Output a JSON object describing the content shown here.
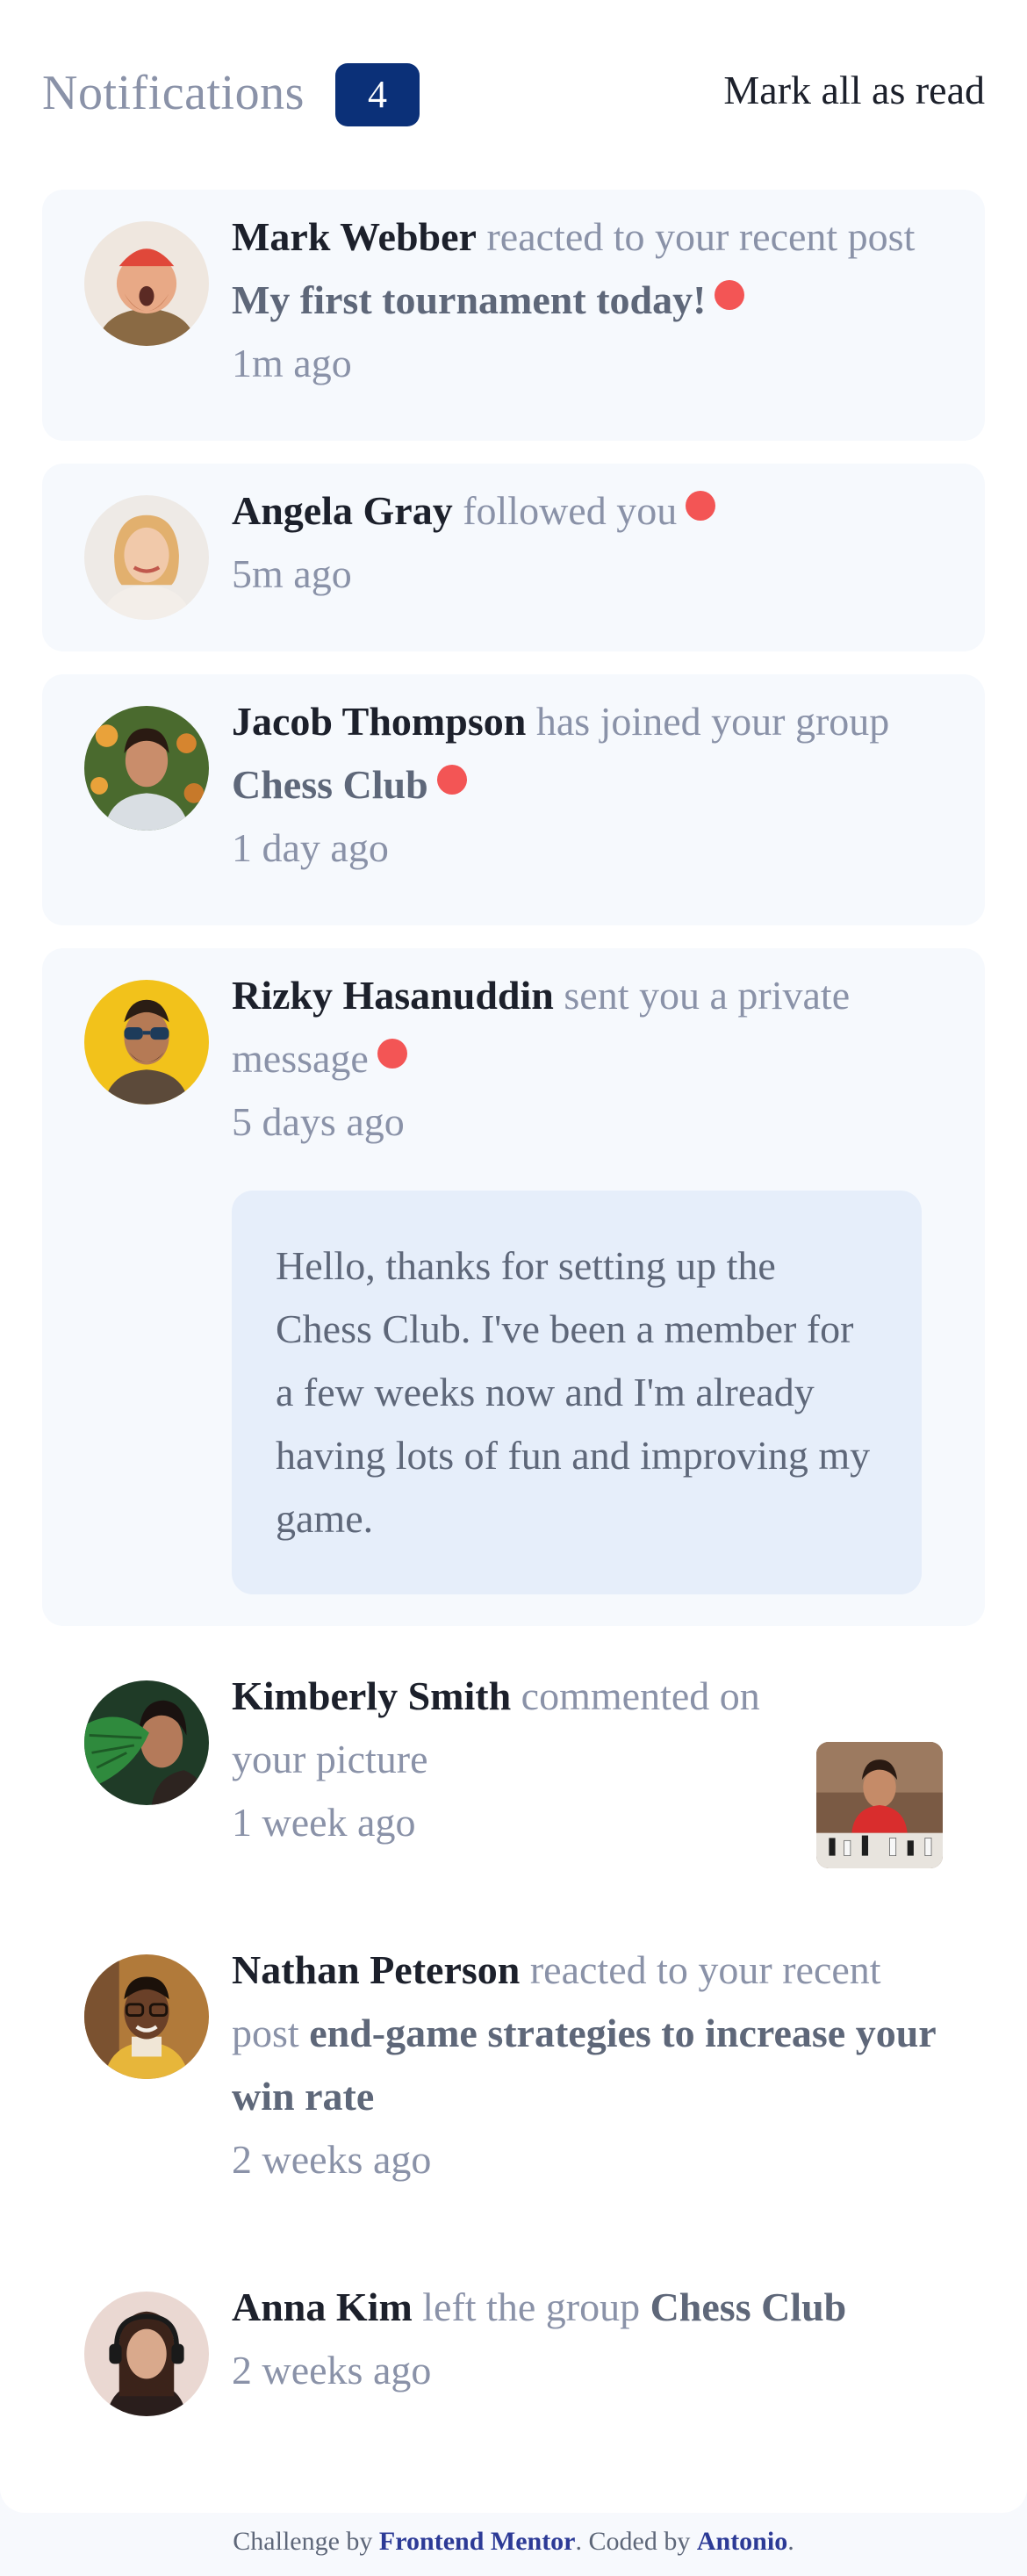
{
  "header": {
    "title": "Notifications",
    "unread_count": "4",
    "mark_all_label": "Mark all as read"
  },
  "notifications": [
    {
      "name": "Mark Webber",
      "action": "reacted to your recent post",
      "target": "My first tournament today!",
      "time": "1m ago",
      "unread": true,
      "avatar": "mark-webber-avatar"
    },
    {
      "name": "Angela Gray",
      "action": "followed you",
      "target": "",
      "time": "5m ago",
      "unread": true,
      "avatar": "angela-gray-avatar"
    },
    {
      "name": "Jacob Thompson",
      "action": "has joined your group",
      "target": "Chess Club",
      "time": "1 day ago",
      "unread": true,
      "avatar": "jacob-thompson-avatar"
    },
    {
      "name": "Rizky Hasanuddin",
      "action": "sent you a private message",
      "target": "",
      "time": "5 days ago",
      "unread": true,
      "avatar": "rizky-hasanuddin-avatar",
      "message": "Hello, thanks for setting up the Chess Club. I've been a member for a few weeks now and I'm already having lots of fun and improving my game."
    },
    {
      "name": "Kimberly Smith",
      "action": "commented on your picture",
      "target": "",
      "time": "1 week ago",
      "unread": false,
      "avatar": "kimberly-smith-avatar",
      "thumbnail": "chess-picture-thumbnail"
    },
    {
      "name": "Nathan Peterson",
      "action": "reacted to your recent post",
      "target": "end-game strategies to increase your win rate",
      "time": "2 weeks ago",
      "unread": false,
      "avatar": "nathan-peterson-avatar"
    },
    {
      "name": "Anna Kim",
      "action": "left the group",
      "target": "Chess Club",
      "time": "2 weeks ago",
      "unread": false,
      "avatar": "anna-kim-avatar"
    }
  ],
  "footer": {
    "prefix": "Challenge by",
    "link1": "Frontend Mentor",
    "middle": ". Coded by",
    "link2": "Antonio",
    "suffix": "."
  },
  "colors": {
    "accent": "#0b3078",
    "unread_dot": "#f35555",
    "unread_bg": "#f6f9fd",
    "message_bg": "#e6eefa",
    "name": "#1c202b",
    "muted": "#8a92a8"
  }
}
